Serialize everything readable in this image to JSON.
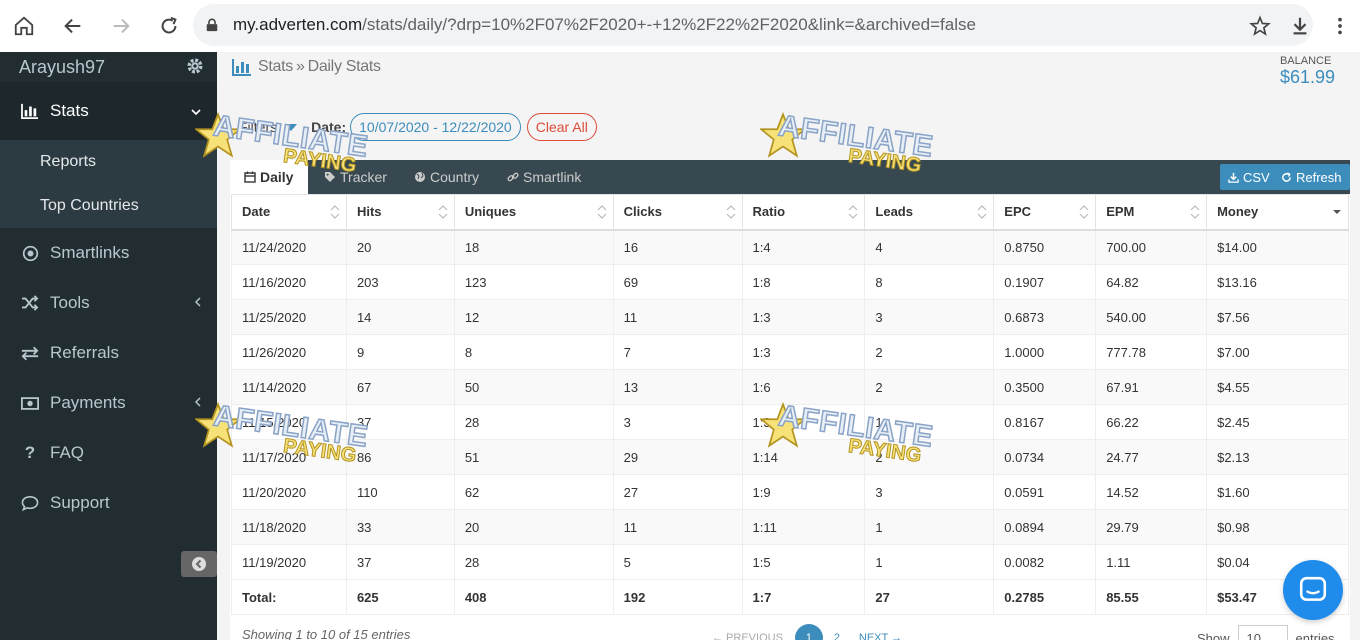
{
  "browser": {
    "url_host": "my.adverten.com",
    "url_path": "/stats/daily/?drp=10%2F07%2F2020+-+12%2F22%2F2020&link=&archived=false"
  },
  "sidebar": {
    "username": "Arayush97",
    "menu": [
      {
        "label": "Stats",
        "icon": "bar-chart-icon",
        "active": true
      },
      {
        "label": "Smartlinks",
        "icon": "target-icon"
      },
      {
        "label": "Tools",
        "icon": "random-icon"
      },
      {
        "label": "Referrals",
        "icon": "exchange-icon"
      },
      {
        "label": "Payments",
        "icon": "money-icon"
      },
      {
        "label": "FAQ",
        "icon": "question-icon"
      },
      {
        "label": "Support",
        "icon": "chat-bubble-icon"
      }
    ],
    "submenu": [
      "Reports",
      "Top Countries"
    ]
  },
  "header": {
    "breadcrumb_root": "Stats",
    "breadcrumb_sep": "»",
    "breadcrumb_current": "Daily Stats",
    "balance_label": "BALANCE",
    "balance_value": "$61.99"
  },
  "filters": {
    "label": "Filters",
    "date_label": "Date:",
    "date_range": "10/07/2020 - 12/22/2020",
    "clear_label": "Clear All"
  },
  "tabs": [
    "Daily",
    "Tracker",
    "Country",
    "Smartlink"
  ],
  "toolbar": {
    "csv_label": "CSV",
    "refresh_label": "Refresh"
  },
  "table": {
    "columns": [
      "Date",
      "Hits",
      "Uniques",
      "Clicks",
      "Ratio",
      "Leads",
      "EPC",
      "EPM",
      "Money"
    ],
    "rows": [
      [
        "11/24/2020",
        "20",
        "18",
        "16",
        "1:4",
        "4",
        "0.8750",
        "700.00",
        "$14.00"
      ],
      [
        "11/16/2020",
        "203",
        "123",
        "69",
        "1:8",
        "8",
        "0.1907",
        "64.82",
        "$13.16"
      ],
      [
        "11/25/2020",
        "14",
        "12",
        "11",
        "1:3",
        "3",
        "0.6873",
        "540.00",
        "$7.56"
      ],
      [
        "11/26/2020",
        "9",
        "8",
        "7",
        "1:3",
        "2",
        "1.0000",
        "777.78",
        "$7.00"
      ],
      [
        "11/14/2020",
        "67",
        "50",
        "13",
        "1:6",
        "2",
        "0.3500",
        "67.91",
        "$4.55"
      ],
      [
        "11/15/2020",
        "37",
        "28",
        "3",
        "1:3",
        "1",
        "0.8167",
        "66.22",
        "$2.45"
      ],
      [
        "11/17/2020",
        "86",
        "51",
        "29",
        "1:14",
        "2",
        "0.0734",
        "24.77",
        "$2.13"
      ],
      [
        "11/20/2020",
        "110",
        "62",
        "27",
        "1:9",
        "3",
        "0.0591",
        "14.52",
        "$1.60"
      ],
      [
        "11/18/2020",
        "33",
        "20",
        "11",
        "1:11",
        "1",
        "0.0894",
        "29.79",
        "$0.98"
      ],
      [
        "11/19/2020",
        "37",
        "28",
        "5",
        "1:5",
        "1",
        "0.0082",
        "1.11",
        "$0.04"
      ]
    ],
    "total": [
      "Total:",
      "625",
      "408",
      "192",
      "1:7",
      "27",
      "0.2785",
      "85.55",
      "$53.47"
    ]
  },
  "footer": {
    "info": "Showing 1 to 10 of 15 entries",
    "prev": "← PREVIOUS",
    "pages": [
      "1",
      "2"
    ],
    "next": "NEXT →",
    "show_label": "Show",
    "show_value": "10",
    "entries_label": "entries"
  },
  "watermark": {
    "line1": "AFFILIATE",
    "line2": "PAYING"
  },
  "colors": {
    "accent": "#3c8dbc",
    "danger": "#dd4b39",
    "sidebar": "#222d32",
    "tabbar": "#374850"
  }
}
